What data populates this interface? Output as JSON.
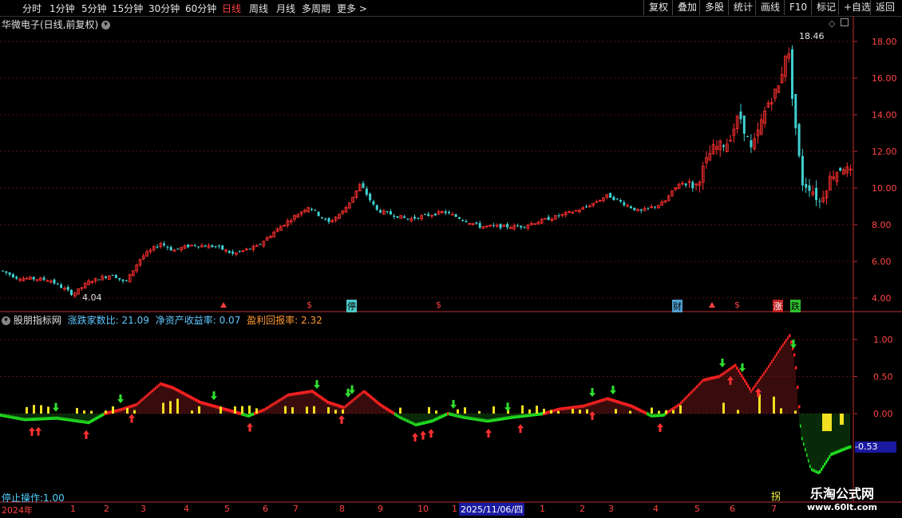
{
  "toolbar": {
    "periods": [
      "分时",
      "1分钟",
      "5分钟",
      "15分钟",
      "30分钟",
      "60分钟",
      "日线",
      "周线",
      "月线",
      "多周期",
      "更多 >"
    ],
    "active": "日线",
    "right_buttons": [
      "复权",
      "叠加",
      "多股",
      "统计",
      "画线",
      "F10",
      "标记",
      "+自选",
      "返回"
    ]
  },
  "main_chart": {
    "title": "华微电子(日线,前复权)",
    "y_ticks": [
      "18.00",
      "16.00",
      "14.00",
      "12.00",
      "10.00",
      "8.00",
      "6.00",
      "4.00"
    ],
    "high_label": "18.46",
    "low_label": "4.04",
    "markers": [
      "停",
      "财",
      "涨",
      "跌"
    ],
    "dollar_marker": "$"
  },
  "indicator": {
    "name": "股朋指标网",
    "item1_label": "涨跌家数比",
    "item1_value": "21.09",
    "item2_label": "净资产收益率",
    "item2_value": "0.07",
    "item3_label": "盈利回报率",
    "item3_value": "2.32",
    "y_ticks": [
      "1.00",
      "0.50",
      "0.00"
    ],
    "current_value": "-0.53",
    "stop_op": "停止操作:1.00"
  },
  "timeline": {
    "year": "2024年",
    "months": [
      "1",
      "2",
      "3",
      "4",
      "5",
      "6",
      "7",
      "8",
      "9",
      "10",
      "1"
    ],
    "months2": [
      "1",
      "2",
      "3",
      "4",
      "5",
      "6",
      "7"
    ],
    "cursor_date": "2025/11/06/四",
    "corner": "拐"
  },
  "watermark": {
    "name": "乐淘公式网",
    "url": "www.60lt.com"
  }
}
